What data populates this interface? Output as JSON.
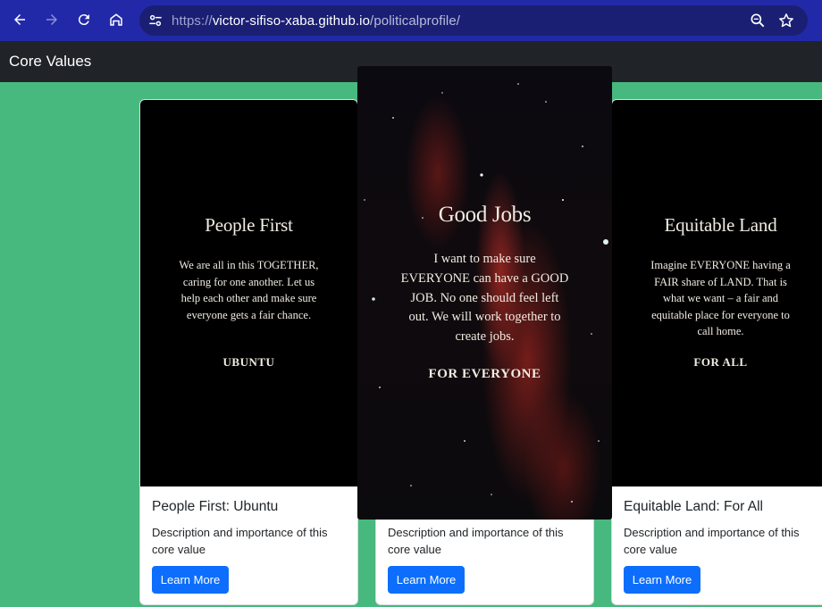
{
  "browser": {
    "url_scheme": "https://",
    "url_host": "victor-sifiso-xaba.github.io",
    "url_path": "/politicalprofile/"
  },
  "site": {
    "brand": "Core Values"
  },
  "cards": [
    {
      "image_title": "People First",
      "image_text": "We are all in this TOGETHER, caring for one another. Let us help each other and make sure everyone gets a fair chance.",
      "image_tag": "UBUNTU",
      "title": "People First: Ubuntu",
      "text": "Description and importance of this core value",
      "button": "Learn More"
    },
    {
      "title": "",
      "text": "Description and importance of this core value",
      "button": "Learn More"
    },
    {
      "image_title": "Equitable Land",
      "image_text": "Imagine EVERYONE having a FAIR share of LAND. That is what we want – a fair and equitable place for everyone to call home.",
      "image_tag": "FOR ALL",
      "title": "Equitable Land: For All",
      "text": "Description and importance of this core value",
      "button": "Learn More"
    }
  ],
  "overlay": {
    "title": "Good Jobs",
    "text": "I want to make sure EVERYONE can have a GOOD  JOB. No one should feel left out. We will work together to create jobs.",
    "tag": "FOR EVERYONE"
  },
  "colors": {
    "page_background": "#47b87e",
    "browser_toolbar": "#2229a8",
    "site_nav": "#202328",
    "button_primary": "#0d6efd"
  }
}
